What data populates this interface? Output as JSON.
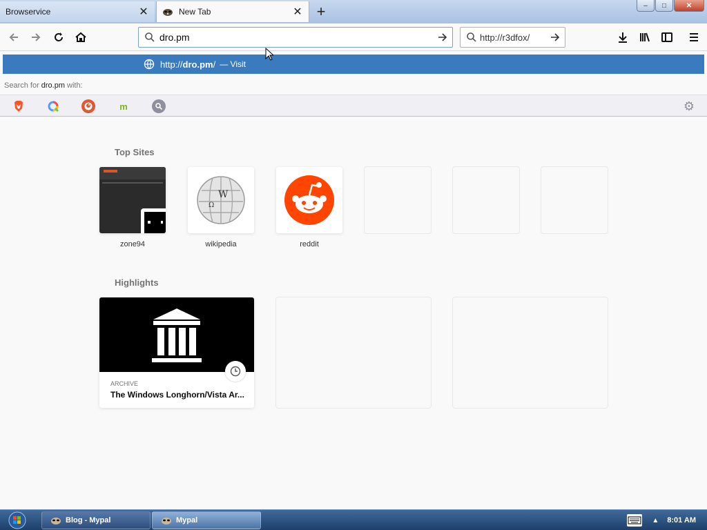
{
  "tabs": [
    {
      "title": "Browservice",
      "active": false
    },
    {
      "title": "New Tab",
      "active": true
    }
  ],
  "new_tab_label": "+",
  "window_controls": {
    "minimize": "–",
    "maximize": "□",
    "close": "✕"
  },
  "urlbar": {
    "value": "dro.pm"
  },
  "searchbar": {
    "value": "http://r3dfox/"
  },
  "autocomplete": {
    "url_prefix": "http://",
    "url_domain": "dro.pm",
    "url_suffix": "/",
    "action": "— Visit",
    "search_with_prefix": "Search for",
    "search_with_term": "dro.pm",
    "search_with_suffix": "with:"
  },
  "top_sites_heading": "Top Sites",
  "top_sites": [
    {
      "label": "zone94"
    },
    {
      "label": "wikipedia"
    },
    {
      "label": "reddit"
    },
    {
      "label": ""
    },
    {
      "label": ""
    },
    {
      "label": ""
    }
  ],
  "highlights_heading": "Highlights",
  "highlights": [
    {
      "source": "ARCHIVE",
      "title": "The Windows Longhorn/Vista Ar..."
    }
  ],
  "taskbar": {
    "items": [
      {
        "label": "Blog - Mypal"
      },
      {
        "label": "Mypal"
      }
    ],
    "clock": "8:01 AM"
  },
  "colors": {
    "accent": "#3a7bbf",
    "reddit": "#ff4500",
    "taskbar": "#1e3f6a"
  }
}
